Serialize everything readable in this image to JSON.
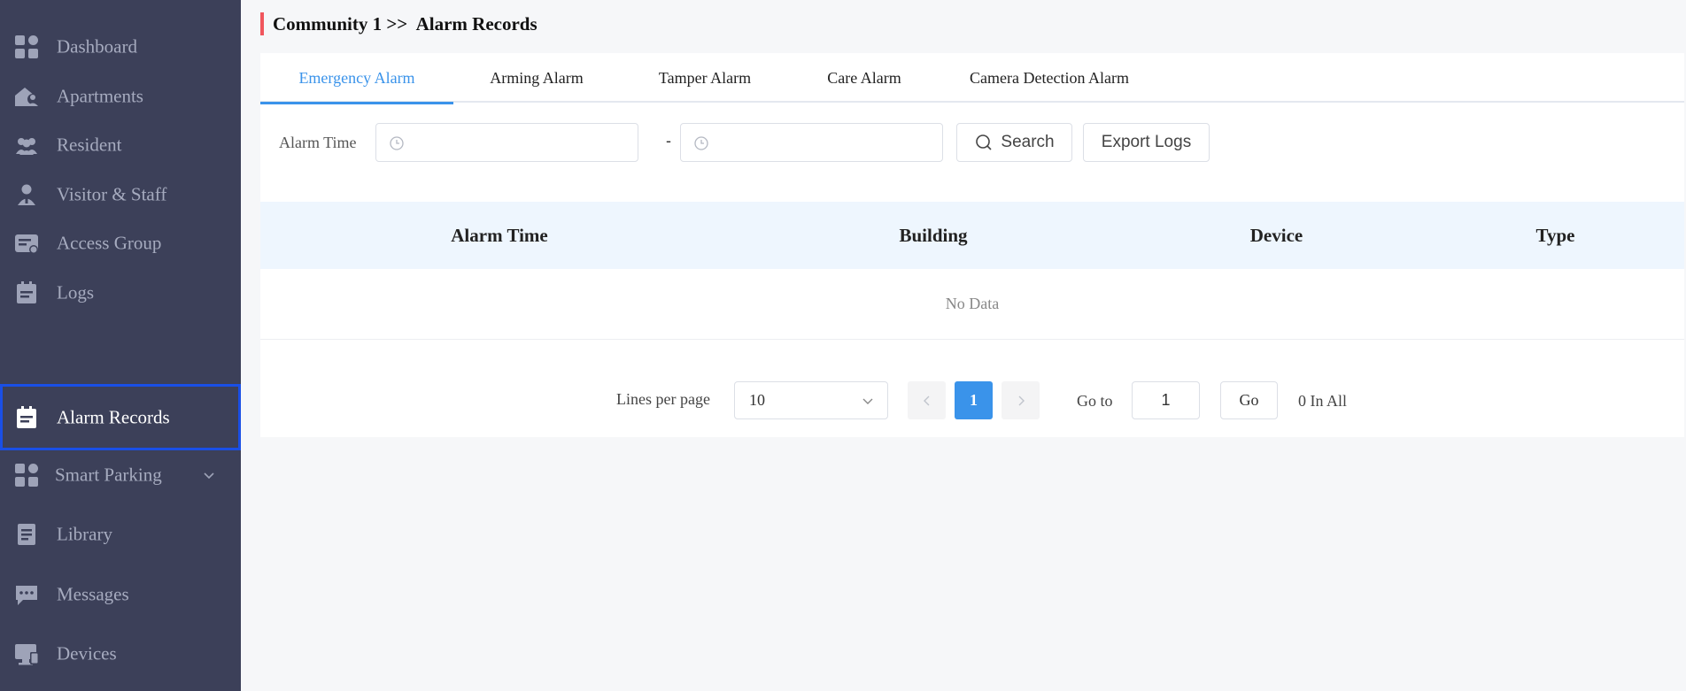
{
  "sidebar": {
    "items": [
      {
        "label": "Dashboard",
        "icon": "dashboard-icon"
      },
      {
        "label": "Apartments",
        "icon": "apartments-icon"
      },
      {
        "label": "Resident",
        "icon": "resident-icon"
      },
      {
        "label": "Visitor & Staff",
        "icon": "visitor-staff-icon"
      },
      {
        "label": "Access Group",
        "icon": "access-group-icon"
      },
      {
        "label": "Logs",
        "icon": "logs-icon"
      },
      {
        "label": "Alarm Records",
        "icon": "alarm-records-icon",
        "active": true
      },
      {
        "label": "Smart Parking",
        "icon": "smart-parking-icon",
        "expandable": true
      },
      {
        "label": "Library",
        "icon": "library-icon"
      },
      {
        "label": "Messages",
        "icon": "messages-icon"
      },
      {
        "label": "Devices",
        "icon": "devices-icon"
      }
    ]
  },
  "breadcrumb": {
    "text": "Community 1 >>  Alarm Records"
  },
  "tabs": [
    {
      "label": "Emergency Alarm",
      "active": true
    },
    {
      "label": "Arming Alarm"
    },
    {
      "label": "Tamper Alarm"
    },
    {
      "label": "Care Alarm"
    },
    {
      "label": "Camera Detection Alarm"
    }
  ],
  "filter": {
    "label": "Alarm Time",
    "start_value": "",
    "end_value": "",
    "separator": "-",
    "search_label": "Search",
    "export_label": "Export Logs"
  },
  "table": {
    "columns": [
      "Alarm Time",
      "Building",
      "Device",
      "Type"
    ],
    "empty_text": "No Data"
  },
  "pagination": {
    "lines_label": "Lines per page",
    "lines_value": "10",
    "current_page": "1",
    "goto_label": "Go to",
    "goto_value": "1",
    "go_label": "Go",
    "total_text": "0 In All"
  },
  "colors": {
    "sidebar_bg": "#3c4059",
    "accent": "#3a93ea",
    "breadcrumb_bar": "#f0565d",
    "active_outline": "#1a4fe6"
  }
}
